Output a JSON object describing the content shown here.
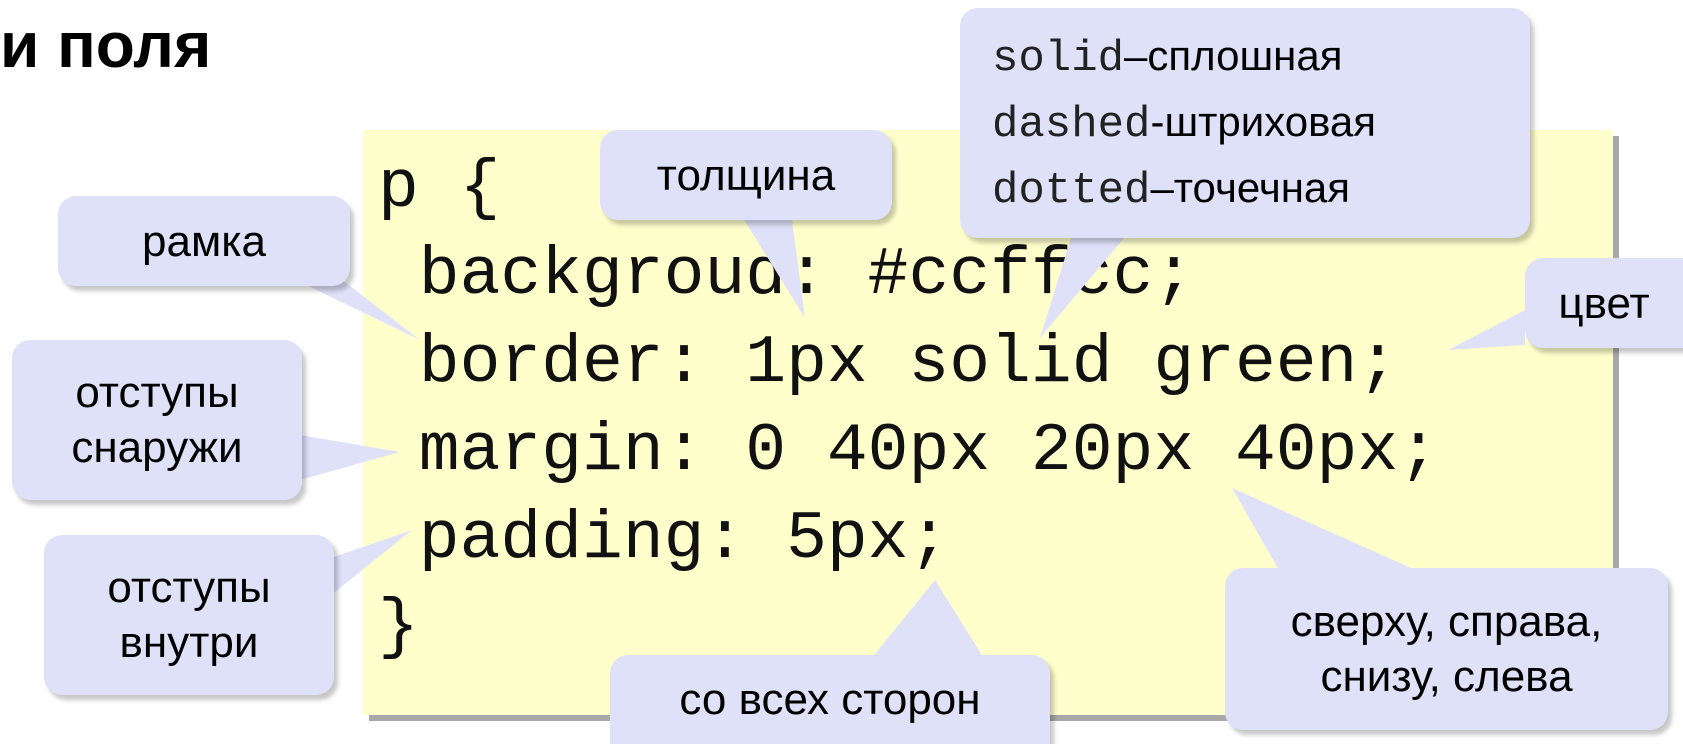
{
  "title": "и поля",
  "code": {
    "lines": [
      "p {",
      " backgroud: #ccffcc;",
      " border: 1px solid green;",
      " margin: 0 40px 20px 40px;",
      " padding: 5px;",
      "}"
    ]
  },
  "bubbles": {
    "thickness": "толщина",
    "frame": "рамка",
    "color": "цвет",
    "margin": [
      "отступы",
      "снаружи"
    ],
    "padding": [
      "отступы",
      "внутри"
    ],
    "all_sides": "со всех сторон",
    "order": [
      "сверху, справа,",
      "снизу, слева"
    ],
    "styles": [
      {
        "keyword": "solid",
        "sep": "– ",
        "desc": "сплошная"
      },
      {
        "keyword": "dashed",
        "sep": " - ",
        "desc": "штриховая"
      },
      {
        "keyword": "dotted",
        "sep": "– ",
        "desc": "точечная"
      }
    ]
  },
  "colors": {
    "code_background": "#ffffcc",
    "bubble_fill": "#dfe1f9"
  }
}
